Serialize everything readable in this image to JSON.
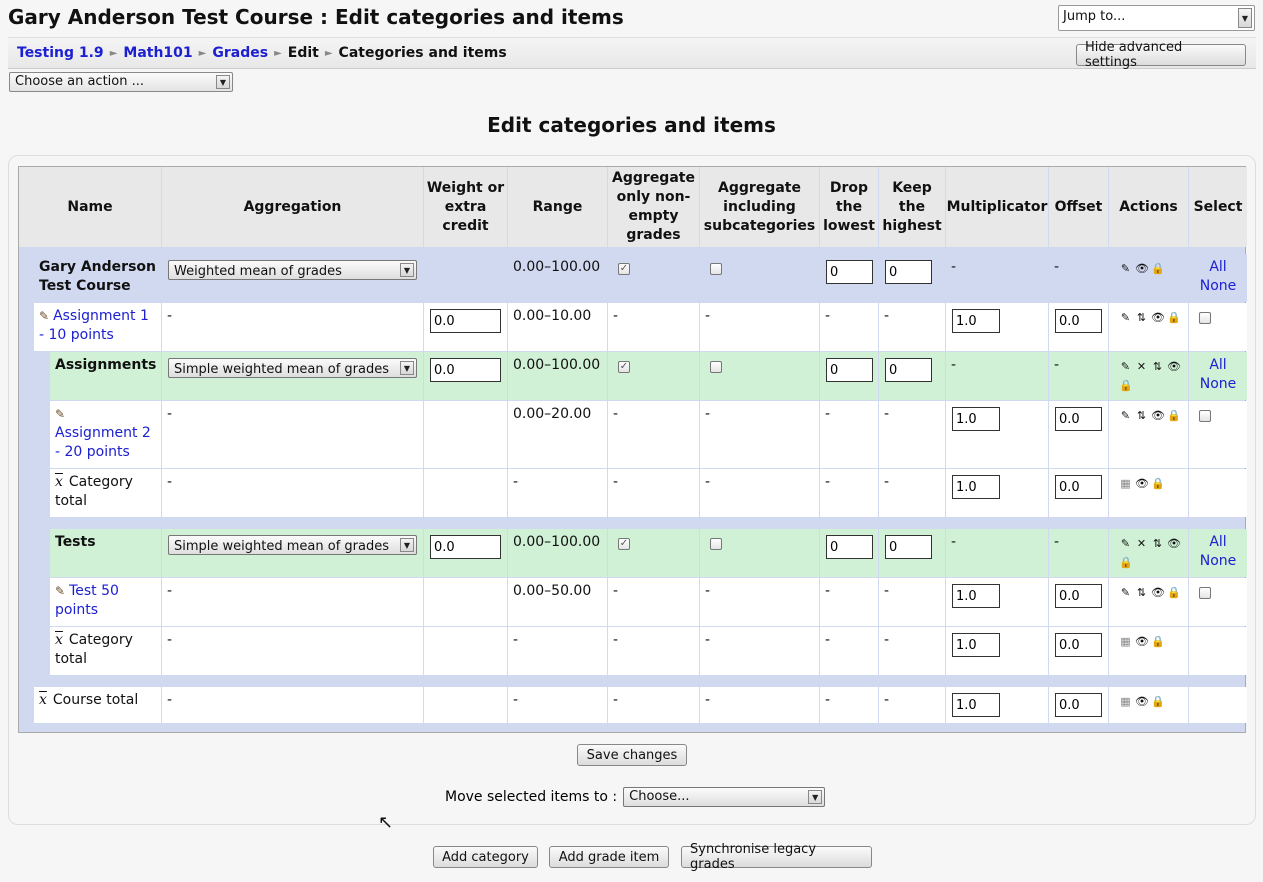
{
  "page": {
    "title": "Gary Anderson Test Course : Edit categories and items",
    "jump_placeholder": "Jump to...",
    "heading": "Edit categories and items"
  },
  "breadcrumb": {
    "items": [
      "Testing 1.9",
      "Math101",
      "Grades",
      "Edit",
      "Categories and items"
    ],
    "separator": "►"
  },
  "toolbar": {
    "hide_advanced": "Hide advanced settings",
    "action_select": "Choose an action ..."
  },
  "table": {
    "headers": [
      "Name",
      "Aggregation",
      "Weight or extra credit",
      "Range",
      "Aggregate only non-empty grades",
      "Aggregate including subcategories",
      "Drop the lowest",
      "Keep the highest",
      "Multiplicator",
      "Offset",
      "Actions",
      "Select"
    ],
    "course": {
      "name": "Gary Anderson Test Course",
      "aggregation": "Weighted mean of grades",
      "range": "0.00–100.00",
      "aggregate_only": true,
      "aggregate_sub": false,
      "drop_lowest": "0",
      "keep_highest": "0",
      "multiplicator": "-",
      "offset": "-",
      "select_all": "All",
      "select_none": "None"
    },
    "assignment1": {
      "name": "Assignment 1 - 10 points",
      "aggregation": "-",
      "weight": "0.0",
      "range": "0.00–10.00",
      "aggregate_only": "-",
      "aggregate_sub": "-",
      "drop_lowest": "-",
      "keep_highest": "-",
      "multiplicator": "1.0",
      "offset": "0.0"
    },
    "assignments": {
      "name": "Assignments",
      "aggregation": "Simple weighted mean of grades",
      "weight": "0.0",
      "range": "0.00–100.00",
      "aggregate_only": true,
      "aggregate_sub": false,
      "drop_lowest": "0",
      "keep_highest": "0",
      "multiplicator": "-",
      "offset": "-",
      "select_all": "All",
      "select_none": "None"
    },
    "assignment2": {
      "name": "Assignment 2 - 20 points",
      "aggregation": "-",
      "range": "0.00–20.00",
      "aggregate_only": "-",
      "aggregate_sub": "-",
      "drop_lowest": "-",
      "keep_highest": "-",
      "multiplicator": "1.0",
      "offset": "0.0"
    },
    "cat_total1": {
      "name": "Category total",
      "aggregation": "-",
      "range": "-",
      "aggregate_only": "-",
      "aggregate_sub": "-",
      "drop_lowest": "-",
      "keep_highest": "-",
      "multiplicator": "1.0",
      "offset": "0.0"
    },
    "tests": {
      "name": "Tests",
      "aggregation": "Simple weighted mean of grades",
      "weight": "0.0",
      "range": "0.00–100.00",
      "aggregate_only": true,
      "aggregate_sub": false,
      "drop_lowest": "0",
      "keep_highest": "0",
      "multiplicator": "-",
      "offset": "-",
      "select_all": "All",
      "select_none": "None"
    },
    "test50": {
      "name": "Test 50 points",
      "aggregation": "-",
      "range": "0.00–50.00",
      "aggregate_only": "-",
      "aggregate_sub": "-",
      "drop_lowest": "-",
      "keep_highest": "-",
      "multiplicator": "1.0",
      "offset": "0.0"
    },
    "cat_total2": {
      "name": "Category total",
      "aggregation": "-",
      "range": "-",
      "aggregate_only": "-",
      "aggregate_sub": "-",
      "drop_lowest": "-",
      "keep_highest": "-",
      "multiplicator": "1.0",
      "offset": "0.0"
    },
    "course_total": {
      "name": "Course total",
      "aggregation": "-",
      "range": "-",
      "aggregate_only": "-",
      "aggregate_sub": "-",
      "drop_lowest": "-",
      "keep_highest": "-",
      "multiplicator": "1.0",
      "offset": "0.0"
    },
    "icons": {
      "edit": "✎",
      "move": "⇅",
      "show": "👁",
      "lock": "🔒",
      "delete": "✕",
      "calc": "▦",
      "item": "✎",
      "xbar": "x"
    }
  },
  "footer": {
    "save": "Save changes",
    "move_label": "Move selected items to :",
    "move_select": "Choose...",
    "add_category": "Add category",
    "add_grade_item": "Add grade item",
    "sync_legacy": "Synchronise legacy grades"
  },
  "colors": {
    "course_row": "#d1d9f1",
    "category_row": "#d0f1d6",
    "link": "#1c20d0"
  }
}
